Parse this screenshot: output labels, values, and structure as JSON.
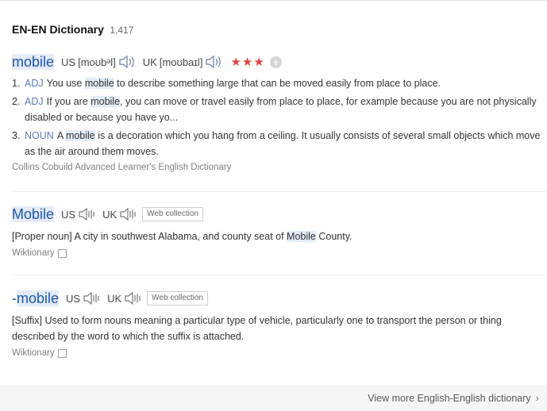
{
  "header": {
    "title": "EN-EN Dictionary",
    "count": "1,417"
  },
  "entries": [
    {
      "word": "mobile",
      "us_label": "US",
      "us_ipa": "[moʊbᵊl]",
      "uk_label": "UK",
      "uk_ipa": "[moʊbaɪl]",
      "stars": "★★★",
      "add_label": "+",
      "senses": [
        {
          "num": "1.",
          "pos": "ADJ",
          "pre": "You use ",
          "hl": "mobile",
          "post": " to describe something large that can be moved easily from place to place."
        },
        {
          "num": "2.",
          "pos": "ADJ",
          "pre": "If you are ",
          "hl": "mobile",
          "post": ", you can move or travel easily from place to place, for example because you are not physically disabled or because you have yo..."
        },
        {
          "num": "3.",
          "pos": "NOUN",
          "pre": "A ",
          "hl": "mobile",
          "post": " is a decoration which you hang from a ceiling. It usually consists of several small objects which move as the air around them moves."
        }
      ],
      "source": "Collins Cobuild Advanced Learner's English Dictionary"
    },
    {
      "word": "Mobile",
      "us_label": "US",
      "uk_label": "UK",
      "badge": "Web collection",
      "def_pre": "[Proper noun] A city in southwest Alabama, and county seat of ",
      "def_hl": "Mobile",
      "def_post": " County.",
      "source": "Wiktionary"
    },
    {
      "word_prefix": "-",
      "word_hl": "mobile",
      "us_label": "US",
      "uk_label": "UK",
      "badge": "Web collection",
      "definition": "[Suffix] Used to form nouns meaning a particular type of vehicle, particularly one to transport the person or thing described by the word to which the suffix is attached.",
      "source": "Wiktionary"
    }
  ],
  "footer": {
    "view_more": "View more English-English dictionary"
  },
  "icons": {
    "speaker": "speaker-icon",
    "external": "external-link-icon",
    "chevron": "chevron-right-icon"
  },
  "colors": {
    "headword": "#1a55b5",
    "pos": "#5d7ab7",
    "stars": "#e2423c",
    "highlight": "#e4ecf7"
  }
}
